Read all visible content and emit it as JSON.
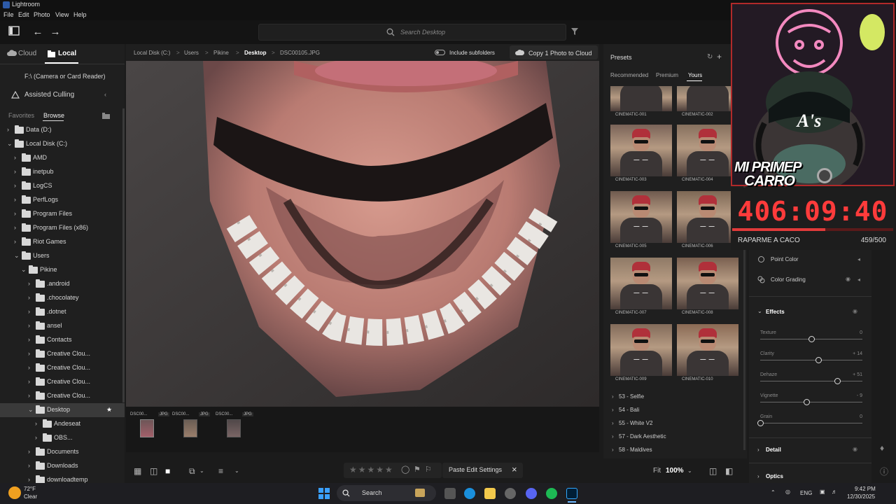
{
  "window": {
    "title": "Lightroom",
    "menu": [
      "File",
      "Edit",
      "Photo",
      "View",
      "Help"
    ]
  },
  "toolbar": {
    "search_placeholder": "Search Desktop"
  },
  "left_panel": {
    "tabs": [
      "Cloud",
      "Local"
    ],
    "active_tab": "Local",
    "camera_item": "F:\\ (Camera or Card Reader)",
    "assisted_culling": "Assisted Culling",
    "subtabs": [
      "Favorites",
      "Browse"
    ],
    "active_subtab": "Browse",
    "tree": [
      {
        "label": "Data (D:)",
        "depth": 0,
        "expanded": false
      },
      {
        "label": "Local Disk (C:)",
        "depth": 0,
        "expanded": true
      },
      {
        "label": "AMD",
        "depth": 1,
        "expanded": false
      },
      {
        "label": "inetpub",
        "depth": 1,
        "expanded": false
      },
      {
        "label": "LogCS",
        "depth": 1,
        "expanded": false
      },
      {
        "label": "PerfLogs",
        "depth": 1,
        "expanded": false
      },
      {
        "label": "Program Files",
        "depth": 1,
        "expanded": false
      },
      {
        "label": "Program Files (x86)",
        "depth": 1,
        "expanded": false
      },
      {
        "label": "Riot Games",
        "depth": 1,
        "expanded": false
      },
      {
        "label": "Users",
        "depth": 1,
        "expanded": true
      },
      {
        "label": "Pikine",
        "depth": 2,
        "expanded": true
      },
      {
        "label": ".android",
        "depth": 3,
        "expanded": false
      },
      {
        "label": ".chocolatey",
        "depth": 3,
        "expanded": false
      },
      {
        "label": ".dotnet",
        "depth": 3,
        "expanded": false
      },
      {
        "label": "ansel",
        "depth": 3,
        "expanded": false
      },
      {
        "label": "Contacts",
        "depth": 3,
        "expanded": false
      },
      {
        "label": "Creative Clou...",
        "depth": 3,
        "expanded": false
      },
      {
        "label": "Creative Clou...",
        "depth": 3,
        "expanded": false
      },
      {
        "label": "Creative Clou...",
        "depth": 3,
        "expanded": false
      },
      {
        "label": "Creative Clou...",
        "depth": 3,
        "expanded": false
      },
      {
        "label": "Desktop",
        "depth": 3,
        "expanded": true,
        "selected": true
      },
      {
        "label": "Andeseat",
        "depth": 4,
        "expanded": false
      },
      {
        "label": "OBS...",
        "depth": 4,
        "expanded": false
      },
      {
        "label": "Documents",
        "depth": 3,
        "expanded": false
      },
      {
        "label": "Downloads",
        "depth": 3,
        "expanded": false
      },
      {
        "label": "downloadtemp",
        "depth": 3,
        "expanded": false
      }
    ]
  },
  "breadcrumb": {
    "parts": [
      "Local Disk (C:)",
      "Users",
      "Pikine",
      "Desktop",
      "DSC00105.JPG"
    ],
    "include_subfolders": "Include subfolders",
    "copy_button": "Copy 1 Photo to Cloud"
  },
  "filmstrip": [
    {
      "name": "DSC00...",
      "type": "JPG"
    },
    {
      "name": "DSC00...",
      "type": "JPG"
    },
    {
      "name": "DSC00...",
      "type": "JPG"
    }
  ],
  "bottom_bar": {
    "paste_button": "Paste Edit Settings",
    "fit_label": "Fit",
    "zoom": "100%"
  },
  "presets": {
    "title": "Presets",
    "tabs": [
      "Recommended",
      "Premium",
      "Yours"
    ],
    "active_tab": "Yours",
    "cards": [
      "CINEMATIC-001",
      "CINEMATIC-002",
      "CINEMATIC-003",
      "CINEMATIC-004",
      "CINEMATIC-005",
      "CINEMATIC-006",
      "CINEMATIC-007",
      "CINEMATIC-008",
      "CINEMATIC-009",
      "CINEMATIC-010"
    ],
    "groups": [
      "53 - Selfie",
      "54 - Bali",
      "55 - White V2",
      "57 - Dark Aesthetic",
      "58 - Maldives"
    ]
  },
  "edit_panel": {
    "point_color": "Point Color",
    "color_grading": "Color Grading",
    "effects": "Effects",
    "sliders": [
      {
        "name": "Texture",
        "value": "0",
        "fraction": 0.5
      },
      {
        "name": "Clarity",
        "value": "+ 14",
        "fraction": 0.57
      },
      {
        "name": "Dehaze",
        "value": "+ 51",
        "fraction": 0.75
      },
      {
        "name": "Vignette",
        "value": "- 9",
        "fraction": 0.45
      },
      {
        "name": "Grain",
        "value": "0",
        "fraction": 0.0
      }
    ],
    "detail": "Detail",
    "optics": "Optics"
  },
  "stream_overlay": {
    "title_line1": "MI PRIMEP",
    "title_line2": "CARRO",
    "timer": "406:09:40",
    "goal_label": "RAPARME A CACO",
    "goal_count": "459/500",
    "goal_fraction": 0.58
  },
  "taskbar": {
    "weather_temp": "72°F",
    "weather_cond": "Clear",
    "search": "Search",
    "lang": "ENG",
    "time": "9:42 PM",
    "date": "12/30/2025"
  },
  "colors": {
    "accent_red": "#ff3b3b",
    "panel_bg": "#1f1f1f",
    "windows_blue": "#1e90ff"
  }
}
